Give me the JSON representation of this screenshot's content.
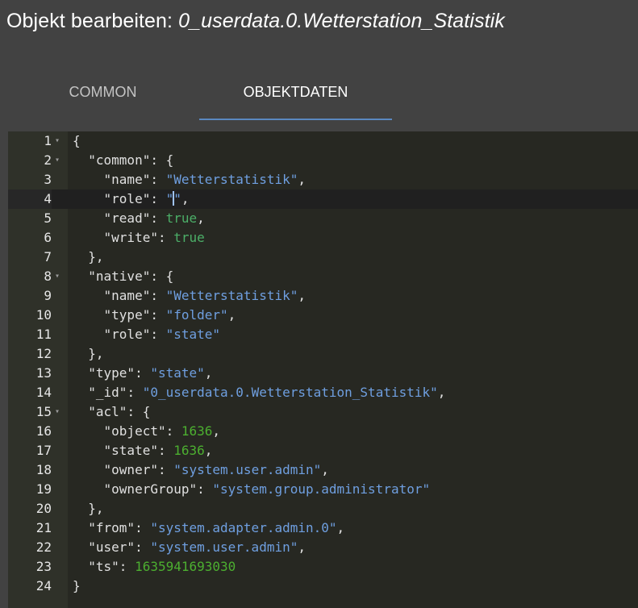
{
  "dialog": {
    "title_prefix": "Objekt bearbeiten:",
    "object_id": "0_userdata.0.Wetterstation_Statistik"
  },
  "tabs": [
    {
      "label": "COMMON",
      "active": false
    },
    {
      "label": "OBJEKTDATEN",
      "active": true
    }
  ],
  "colors": {
    "background": "#424242",
    "editor_background": "#272822",
    "gutter_background": "#2f3129",
    "tab_indicator": "#5a88c0",
    "string": "#6f9fe0",
    "boolean": "#4caf68",
    "number": "#4caf30"
  },
  "editor": {
    "active_line": 4,
    "fold_icons": "fold-arrow-icon",
    "lines": [
      {
        "n": "1",
        "fold": true,
        "code": [
          {
            "t": "punc",
            "v": "{"
          }
        ]
      },
      {
        "n": "2",
        "fold": true,
        "code": [
          {
            "t": "key",
            "v": "  \"common\""
          },
          {
            "t": "punc",
            "v": ": {"
          }
        ]
      },
      {
        "n": "3",
        "fold": false,
        "code": [
          {
            "t": "key",
            "v": "    \"name\""
          },
          {
            "t": "punc",
            "v": ": "
          },
          {
            "t": "str",
            "v": "\"Wetterstatistik\""
          },
          {
            "t": "punc",
            "v": ","
          }
        ]
      },
      {
        "n": "4",
        "fold": false,
        "code": [
          {
            "t": "key",
            "v": "    \"role\""
          },
          {
            "t": "punc",
            "v": ": "
          },
          {
            "t": "str",
            "v": "\""
          },
          {
            "t": "cursor",
            "v": ""
          },
          {
            "t": "str",
            "v": "\""
          },
          {
            "t": "punc",
            "v": ","
          }
        ]
      },
      {
        "n": "5",
        "fold": false,
        "code": [
          {
            "t": "key",
            "v": "    \"read\""
          },
          {
            "t": "punc",
            "v": ": "
          },
          {
            "t": "bool",
            "v": "true"
          },
          {
            "t": "punc",
            "v": ","
          }
        ]
      },
      {
        "n": "6",
        "fold": false,
        "code": [
          {
            "t": "key",
            "v": "    \"write\""
          },
          {
            "t": "punc",
            "v": ": "
          },
          {
            "t": "bool",
            "v": "true"
          }
        ]
      },
      {
        "n": "7",
        "fold": false,
        "code": [
          {
            "t": "punc",
            "v": "  },"
          }
        ]
      },
      {
        "n": "8",
        "fold": true,
        "code": [
          {
            "t": "key",
            "v": "  \"native\""
          },
          {
            "t": "punc",
            "v": ": {"
          }
        ]
      },
      {
        "n": "9",
        "fold": false,
        "code": [
          {
            "t": "key",
            "v": "    \"name\""
          },
          {
            "t": "punc",
            "v": ": "
          },
          {
            "t": "str",
            "v": "\"Wetterstatistik\""
          },
          {
            "t": "punc",
            "v": ","
          }
        ]
      },
      {
        "n": "10",
        "fold": false,
        "code": [
          {
            "t": "key",
            "v": "    \"type\""
          },
          {
            "t": "punc",
            "v": ": "
          },
          {
            "t": "str",
            "v": "\"folder\""
          },
          {
            "t": "punc",
            "v": ","
          }
        ]
      },
      {
        "n": "11",
        "fold": false,
        "code": [
          {
            "t": "key",
            "v": "    \"role\""
          },
          {
            "t": "punc",
            "v": ": "
          },
          {
            "t": "str",
            "v": "\"state\""
          }
        ]
      },
      {
        "n": "12",
        "fold": false,
        "code": [
          {
            "t": "punc",
            "v": "  },"
          }
        ]
      },
      {
        "n": "13",
        "fold": false,
        "code": [
          {
            "t": "key",
            "v": "  \"type\""
          },
          {
            "t": "punc",
            "v": ": "
          },
          {
            "t": "str",
            "v": "\"state\""
          },
          {
            "t": "punc",
            "v": ","
          }
        ]
      },
      {
        "n": "14",
        "fold": false,
        "code": [
          {
            "t": "key",
            "v": "  \"_id\""
          },
          {
            "t": "punc",
            "v": ": "
          },
          {
            "t": "str",
            "v": "\"0_userdata.0.Wetterstation_Statistik\""
          },
          {
            "t": "punc",
            "v": ","
          }
        ]
      },
      {
        "n": "15",
        "fold": true,
        "code": [
          {
            "t": "key",
            "v": "  \"acl\""
          },
          {
            "t": "punc",
            "v": ": {"
          }
        ]
      },
      {
        "n": "16",
        "fold": false,
        "code": [
          {
            "t": "key",
            "v": "    \"object\""
          },
          {
            "t": "punc",
            "v": ": "
          },
          {
            "t": "num",
            "v": "1636"
          },
          {
            "t": "punc",
            "v": ","
          }
        ]
      },
      {
        "n": "17",
        "fold": false,
        "code": [
          {
            "t": "key",
            "v": "    \"state\""
          },
          {
            "t": "punc",
            "v": ": "
          },
          {
            "t": "num",
            "v": "1636"
          },
          {
            "t": "punc",
            "v": ","
          }
        ]
      },
      {
        "n": "18",
        "fold": false,
        "code": [
          {
            "t": "key",
            "v": "    \"owner\""
          },
          {
            "t": "punc",
            "v": ": "
          },
          {
            "t": "str",
            "v": "\"system.user.admin\""
          },
          {
            "t": "punc",
            "v": ","
          }
        ]
      },
      {
        "n": "19",
        "fold": false,
        "code": [
          {
            "t": "key",
            "v": "    \"ownerGroup\""
          },
          {
            "t": "punc",
            "v": ": "
          },
          {
            "t": "str",
            "v": "\"system.group.administrator\""
          }
        ]
      },
      {
        "n": "20",
        "fold": false,
        "code": [
          {
            "t": "punc",
            "v": "  },"
          }
        ]
      },
      {
        "n": "21",
        "fold": false,
        "code": [
          {
            "t": "key",
            "v": "  \"from\""
          },
          {
            "t": "punc",
            "v": ": "
          },
          {
            "t": "str",
            "v": "\"system.adapter.admin.0\""
          },
          {
            "t": "punc",
            "v": ","
          }
        ]
      },
      {
        "n": "22",
        "fold": false,
        "code": [
          {
            "t": "key",
            "v": "  \"user\""
          },
          {
            "t": "punc",
            "v": ": "
          },
          {
            "t": "str",
            "v": "\"system.user.admin\""
          },
          {
            "t": "punc",
            "v": ","
          }
        ]
      },
      {
        "n": "23",
        "fold": false,
        "code": [
          {
            "t": "key",
            "v": "  \"ts\""
          },
          {
            "t": "punc",
            "v": ": "
          },
          {
            "t": "num",
            "v": "1635941693030"
          }
        ]
      },
      {
        "n": "24",
        "fold": false,
        "code": [
          {
            "t": "punc",
            "v": "}"
          }
        ]
      }
    ]
  }
}
